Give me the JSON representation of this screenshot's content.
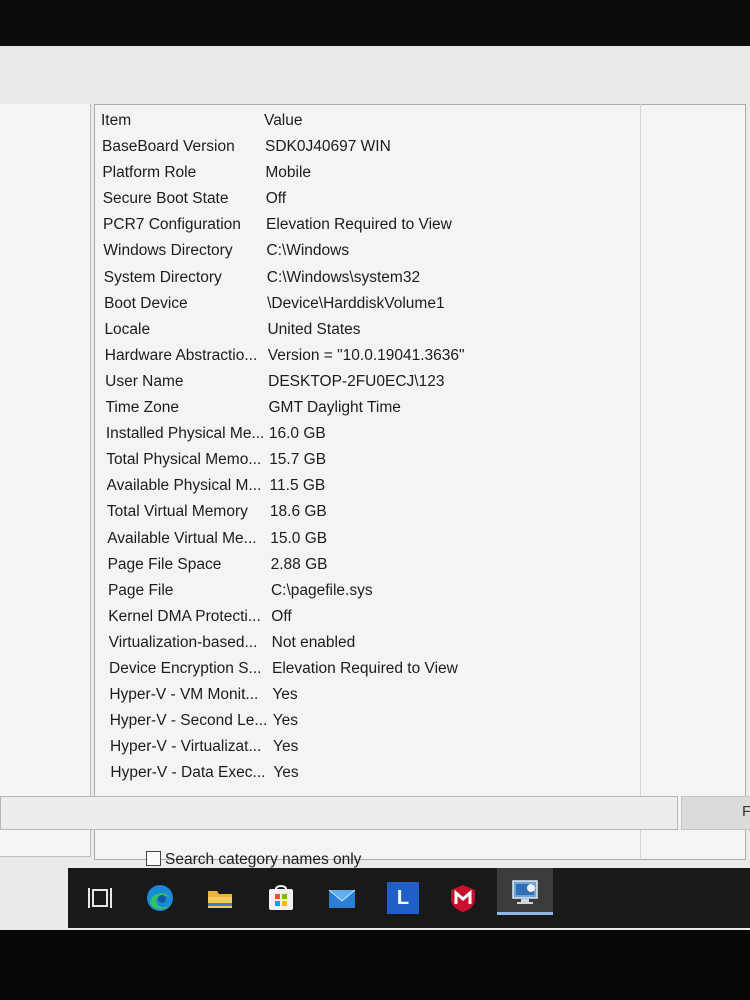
{
  "list": {
    "headers": {
      "item": "Item",
      "value": "Value"
    },
    "rows": [
      {
        "item": "BaseBoard Version",
        "value": "SDK0J40697 WIN"
      },
      {
        "item": "Platform Role",
        "value": "Mobile"
      },
      {
        "item": "Secure Boot State",
        "value": "Off"
      },
      {
        "item": "PCR7 Configuration",
        "value": "Elevation Required to View"
      },
      {
        "item": "Windows Directory",
        "value": "C:\\Windows"
      },
      {
        "item": "System Directory",
        "value": "C:\\Windows\\system32"
      },
      {
        "item": "Boot Device",
        "value": "\\Device\\HarddiskVolume1"
      },
      {
        "item": "Locale",
        "value": "United States"
      },
      {
        "item": "Hardware Abstractio...",
        "value": "Version = \"10.0.19041.3636\""
      },
      {
        "item": "User Name",
        "value": "DESKTOP-2FU0ECJ\\123"
      },
      {
        "item": "Time Zone",
        "value": "GMT Daylight Time"
      },
      {
        "item": "Installed Physical Me...",
        "value": "16.0 GB"
      },
      {
        "item": "Total Physical Memo...",
        "value": "15.7 GB"
      },
      {
        "item": "Available Physical M...",
        "value": "11.5 GB"
      },
      {
        "item": "Total Virtual Memory",
        "value": "18.6 GB"
      },
      {
        "item": "Available Virtual Me...",
        "value": "15.0 GB"
      },
      {
        "item": "Page File Space",
        "value": "2.88 GB"
      },
      {
        "item": "Page File",
        "value": "C:\\pagefile.sys"
      },
      {
        "item": "Kernel DMA Protecti...",
        "value": "Off"
      },
      {
        "item": "Virtualization-based...",
        "value": "Not enabled"
      },
      {
        "item": "Device Encryption S...",
        "value": "Elevation Required to View"
      },
      {
        "item": "Hyper-V - VM Monit...",
        "value": "Yes"
      },
      {
        "item": "Hyper-V - Second Le...",
        "value": "Yes"
      },
      {
        "item": "Hyper-V - Virtualizat...",
        "value": "Yes"
      },
      {
        "item": "Hyper-V - Data Exec...",
        "value": "Yes"
      }
    ]
  },
  "find": {
    "button_label": "F"
  },
  "search": {
    "checkbox_label": "Search category names only",
    "checked": false
  },
  "taskbar": {
    "apps": [
      {
        "icon": "task-view-icon"
      },
      {
        "icon": "edge-icon"
      },
      {
        "icon": "file-explorer-icon"
      },
      {
        "icon": "microsoft-store-icon"
      },
      {
        "icon": "mail-icon"
      },
      {
        "icon": "l-app-icon",
        "letter": "L"
      },
      {
        "icon": "mcafee-icon"
      },
      {
        "icon": "system-information-icon",
        "active": true
      }
    ]
  },
  "colors": {
    "taskbar": "#191919",
    "list_background": "#f3f4f3",
    "active_indicator": "#8fb7e6"
  }
}
